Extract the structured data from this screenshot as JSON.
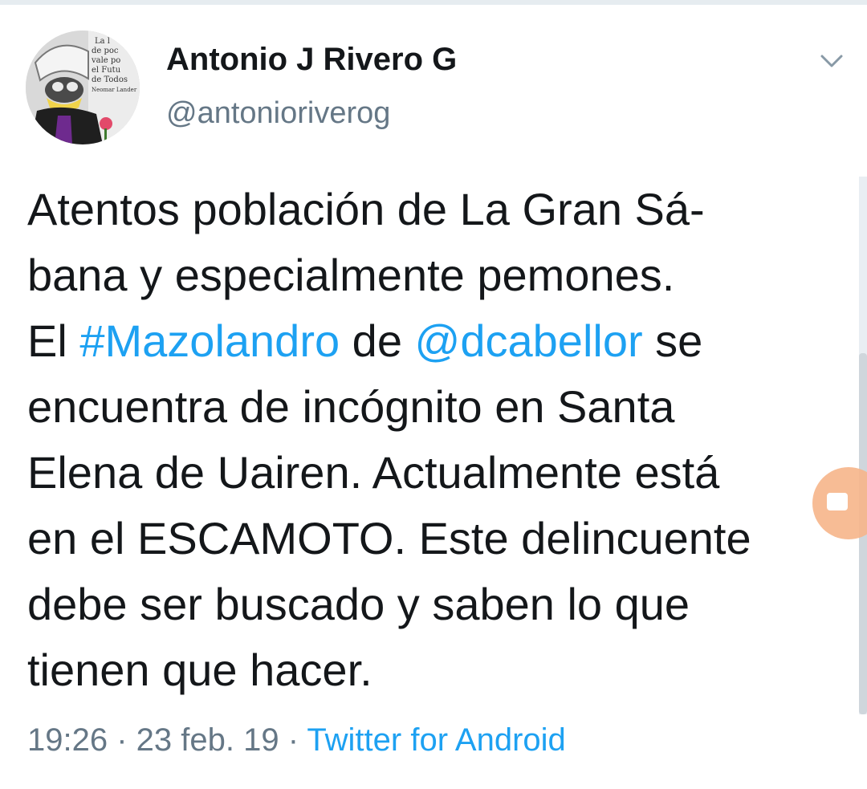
{
  "tweet": {
    "author": {
      "display_name": "Antonio J Rivero G",
      "handle": "@antonioriverog",
      "avatar_icon": "profile-photo-icon",
      "avatar_text": [
        "La l",
        "de poc",
        "vale po",
        "el Futu",
        "de Todos",
        "Neomar Lander"
      ]
    },
    "menu_icon": "chevron-down-icon",
    "text": {
      "line1": "Atentos población de La Gran Sá-",
      "line2": "bana y especialmente pemones.",
      "line3_a": "El ",
      "hashtag": "#Mazolandro",
      "line3_b": " de ",
      "mention": "@dcabellor",
      "line3_c": " se",
      "line4": "encuentra de incógnito en Santa",
      "line5": "Elena de Uairen. Actualmente está",
      "line6": "en el ESCAMOTO. Este delincuente",
      "line7": "debe ser buscado y saben lo que",
      "line8": "tienen que hacer."
    },
    "meta": {
      "time": "19:26",
      "separator": " · ",
      "date": "23 feb. 19",
      "source": "Twitter for Android"
    }
  },
  "colors": {
    "text_primary": "#14171a",
    "text_secondary": "#657786",
    "link": "#1da1f2",
    "divider": "#e6ecf0",
    "bubble": "#f6b58a"
  }
}
